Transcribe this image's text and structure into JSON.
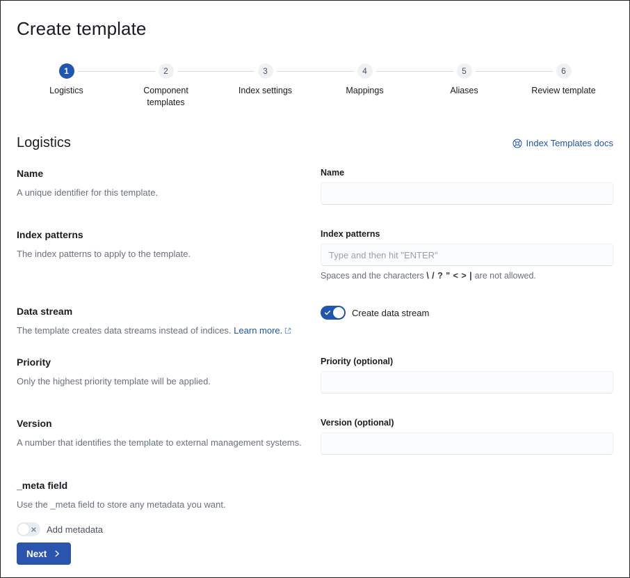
{
  "header": {
    "title": "Create template"
  },
  "stepper": {
    "steps": [
      {
        "number": "1",
        "label": "Logistics",
        "active": true
      },
      {
        "number": "2",
        "label": "Component templates",
        "active": false
      },
      {
        "number": "3",
        "label": "Index settings",
        "active": false
      },
      {
        "number": "4",
        "label": "Mappings",
        "active": false
      },
      {
        "number": "5",
        "label": "Aliases",
        "active": false
      },
      {
        "number": "6",
        "label": "Review template",
        "active": false
      }
    ]
  },
  "section": {
    "title": "Logistics",
    "docs_link": {
      "label": "Index Templates docs",
      "icon": "help-circle-icon"
    }
  },
  "fields": {
    "name": {
      "title": "Name",
      "description": "A unique identifier for this template.",
      "input_label": "Name",
      "value": "",
      "placeholder": ""
    },
    "index_patterns": {
      "title": "Index patterns",
      "description": "The index patterns to apply to the template.",
      "input_label": "Index patterns",
      "value": "",
      "placeholder": "Type and then hit \"ENTER\"",
      "help_prefix": "Spaces and the characters",
      "help_chars": "\\ / ? \" < > |",
      "help_suffix": "are not allowed."
    },
    "data_stream": {
      "title": "Data stream",
      "description_prefix": "The template creates data streams instead of indices.",
      "learn_more_label": "Learn more.",
      "toggle_label": "Create data stream",
      "toggle_on": true
    },
    "priority": {
      "title": "Priority",
      "description": "Only the highest priority template will be applied.",
      "input_label": "Priority (optional)",
      "value": "",
      "placeholder": ""
    },
    "version": {
      "title": "Version",
      "description": "A number that identifies the template to external management systems.",
      "input_label": "Version (optional)",
      "value": "",
      "placeholder": ""
    },
    "meta_field": {
      "title": "_meta field",
      "description": "Use the _meta field to store any metadata you want.",
      "toggle_label": "Add metadata",
      "toggle_on": false
    }
  },
  "footer": {
    "next_label": "Next"
  },
  "colors": {
    "accent": "#1f56b4",
    "button": "#2a54ad",
    "text": "#1a1c21",
    "muted": "#6a717d",
    "border": "#d3dae6"
  }
}
